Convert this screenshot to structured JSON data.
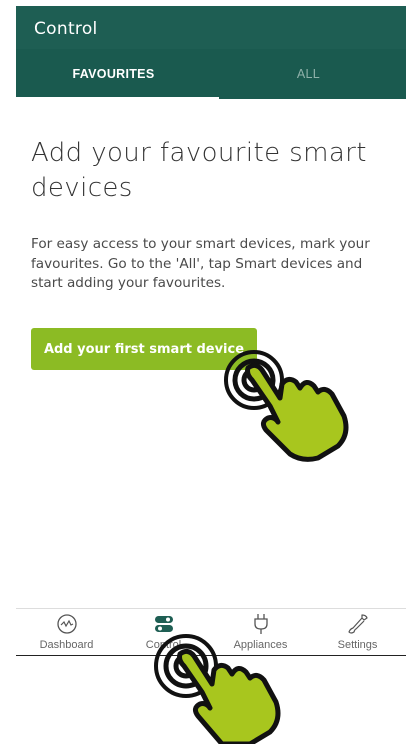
{
  "app": {
    "title": "Control"
  },
  "tabs": [
    {
      "label": "FAVOURITES",
      "active": true
    },
    {
      "label": "ALL",
      "active": false
    }
  ],
  "empty_state": {
    "heading": "Add your favourite smart devices",
    "description": "For easy access to your smart devices, mark your favourites. Go to the 'All', tap Smart devices and start adding your favourites.",
    "button_label": "Add your first smart device"
  },
  "bottom_nav": [
    {
      "label": "Dashboard",
      "icon": "dashboard-gauge-icon",
      "active": false
    },
    {
      "label": "Control",
      "icon": "toggle-switches-icon",
      "active": true
    },
    {
      "label": "Appliances",
      "icon": "plug-icon",
      "active": false
    },
    {
      "label": "Settings",
      "icon": "wrench-icon",
      "active": false
    }
  ],
  "colors": {
    "appbar": "#1e5e53",
    "tabbar": "#1a5a4f",
    "accent_green": "#8cbb24",
    "hand_green": "#a8c61e"
  }
}
